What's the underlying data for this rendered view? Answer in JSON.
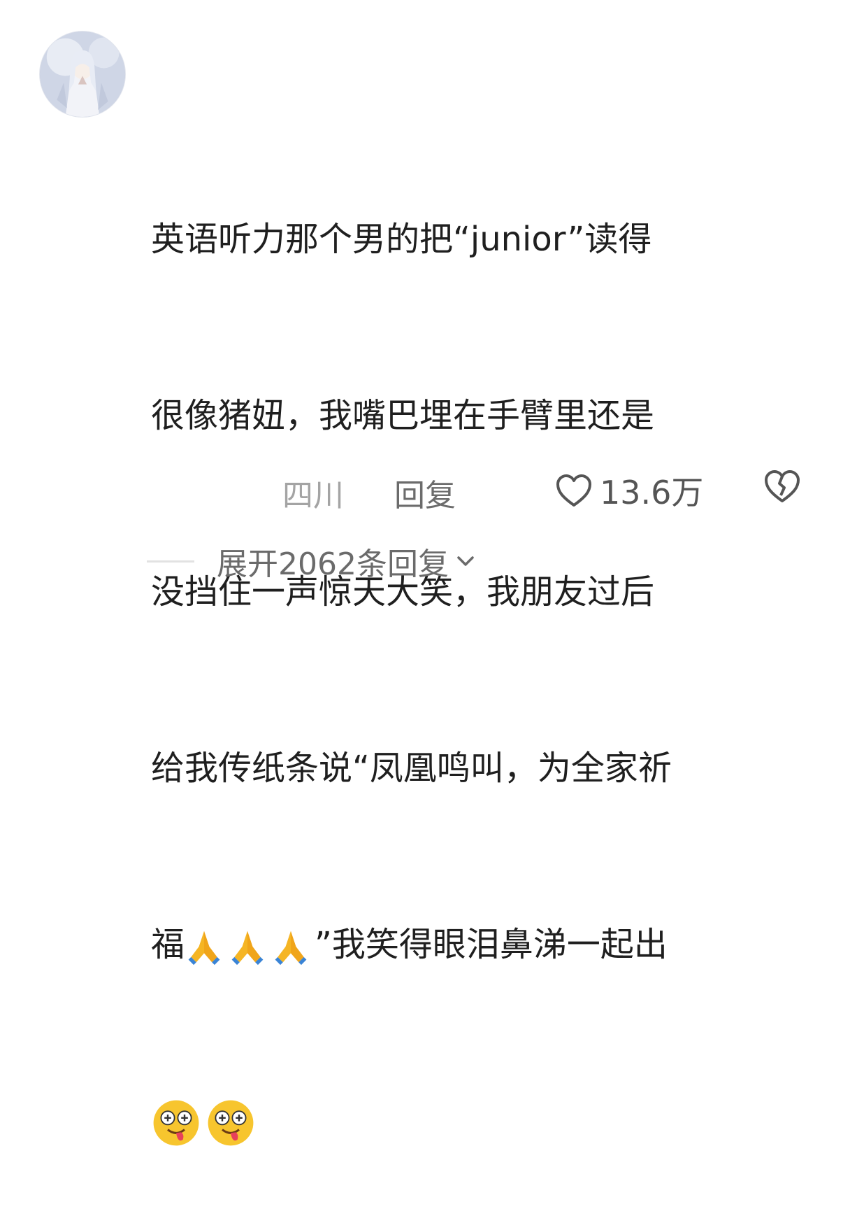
{
  "comment": {
    "lines": [
      "英语听力那个男的把“junior”读得",
      "很像猪妞，我嘴巴埋在手臂里还是",
      "没挡住一声惊天大笑，我朋友过后",
      "给我传纸条说“凤凰鸣叫，为全家祈",
      "",
      ""
    ],
    "line5_prefix": "福",
    "line5_suffix": "”我笑得眼泪鼻涕一起出",
    "emoji_icons": [
      "folded-hands-icon",
      "folded-hands-icon",
      "folded-hands-icon",
      "dizzy-tongue-face-icon",
      "dizzy-tongue-face-icon"
    ]
  },
  "meta": {
    "location": "四川",
    "reply_label": "回复",
    "like_count": "13.6万",
    "like_icon": "heart-outline-icon",
    "dislike_icon": "broken-heart-icon"
  },
  "expand": {
    "label": "展开2062条回复",
    "icon": "chevron-down-icon"
  },
  "colors": {
    "text": "#1f1f1f",
    "secondary": "#6b6b6b",
    "muted": "#a4a4a4"
  }
}
